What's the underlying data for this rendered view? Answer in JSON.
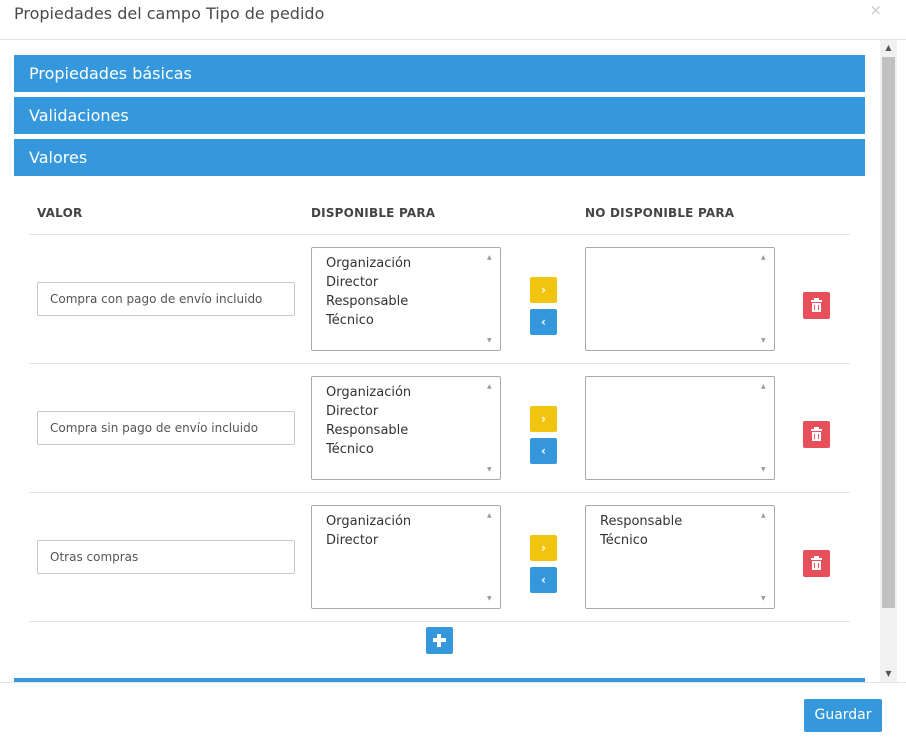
{
  "dialog": {
    "title": "Propiedades del campo Tipo de pedido",
    "close_icon": "×"
  },
  "panels": [
    {
      "label": "Propiedades básicas"
    },
    {
      "label": "Validaciones"
    },
    {
      "label": "Valores"
    }
  ],
  "table": {
    "headers": {
      "value": "VALOR",
      "available": "DISPONIBLE PARA",
      "not_available": "NO DISPONIBLE PARA"
    },
    "rows": [
      {
        "value": "Compra con pago de envío incluido",
        "available": [
          "Organización",
          "Director",
          "Responsable",
          "Técnico"
        ],
        "not_available": []
      },
      {
        "value": "Compra sin pago de envío incluido",
        "available": [
          "Organización",
          "Director",
          "Responsable",
          "Técnico"
        ],
        "not_available": []
      },
      {
        "value": "Otras compras",
        "available": [
          "Organización",
          "Director"
        ],
        "not_available": [
          "Responsable",
          "Técnico"
        ]
      }
    ]
  },
  "buttons": {
    "move_right": "›",
    "move_left": "‹",
    "save": "Guardar"
  },
  "colors": {
    "primary": "#3598dc",
    "warning": "#f1c40f",
    "danger": "#e7505a"
  }
}
